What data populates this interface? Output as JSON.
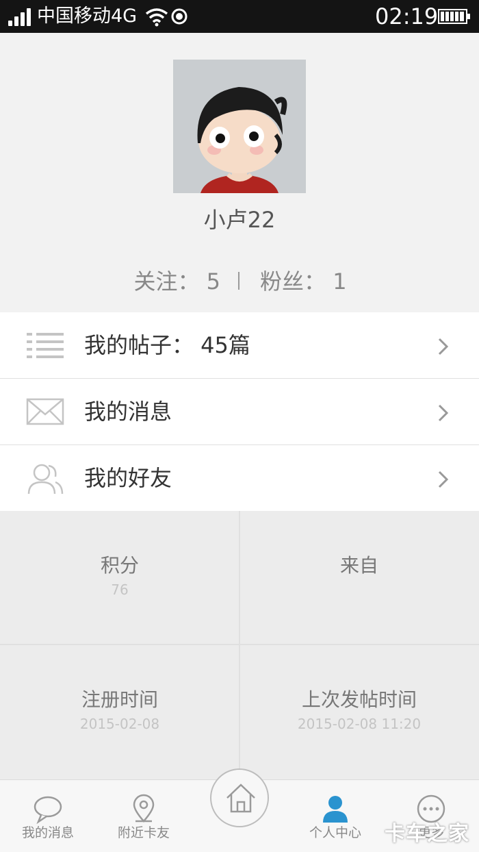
{
  "status_bar": {
    "carrier": "中国移动4G",
    "time": "02:19",
    "icons": [
      "signal-icon",
      "wifi-icon",
      "location-icon",
      "battery-icon"
    ]
  },
  "profile": {
    "username": "小卢22",
    "follow_label": "关注：",
    "follow_count": "5",
    "fans_label": "粉丝：",
    "fans_count": "1"
  },
  "menu": [
    {
      "label": "我的帖子：  45篇",
      "icon": "list-icon"
    },
    {
      "label": "我的消息",
      "icon": "mail-icon"
    },
    {
      "label": "我的好友",
      "icon": "friends-icon"
    }
  ],
  "stats": [
    {
      "title": "积分",
      "value": "76"
    },
    {
      "title": "来自",
      "value": ""
    },
    {
      "title": "注册时间",
      "value": "2015-02-08"
    },
    {
      "title": "上次发帖时间",
      "value": "2015-02-08 11:20"
    }
  ],
  "tabs": [
    {
      "label": "我的消息",
      "icon": "chat-bubble-icon"
    },
    {
      "label": "附近卡友",
      "icon": "map-pin-icon"
    },
    {
      "label": "",
      "icon": "home-icon"
    },
    {
      "label": "个人中心",
      "icon": "person-icon"
    },
    {
      "label": "更多",
      "icon": "more-icon"
    }
  ],
  "watermark": "卡车之家",
  "colors": {
    "status_bar_bg": "#141414",
    "accent": "#2a93cf",
    "page_bg": "#f2f2f2",
    "grid_bg": "#ececec"
  }
}
